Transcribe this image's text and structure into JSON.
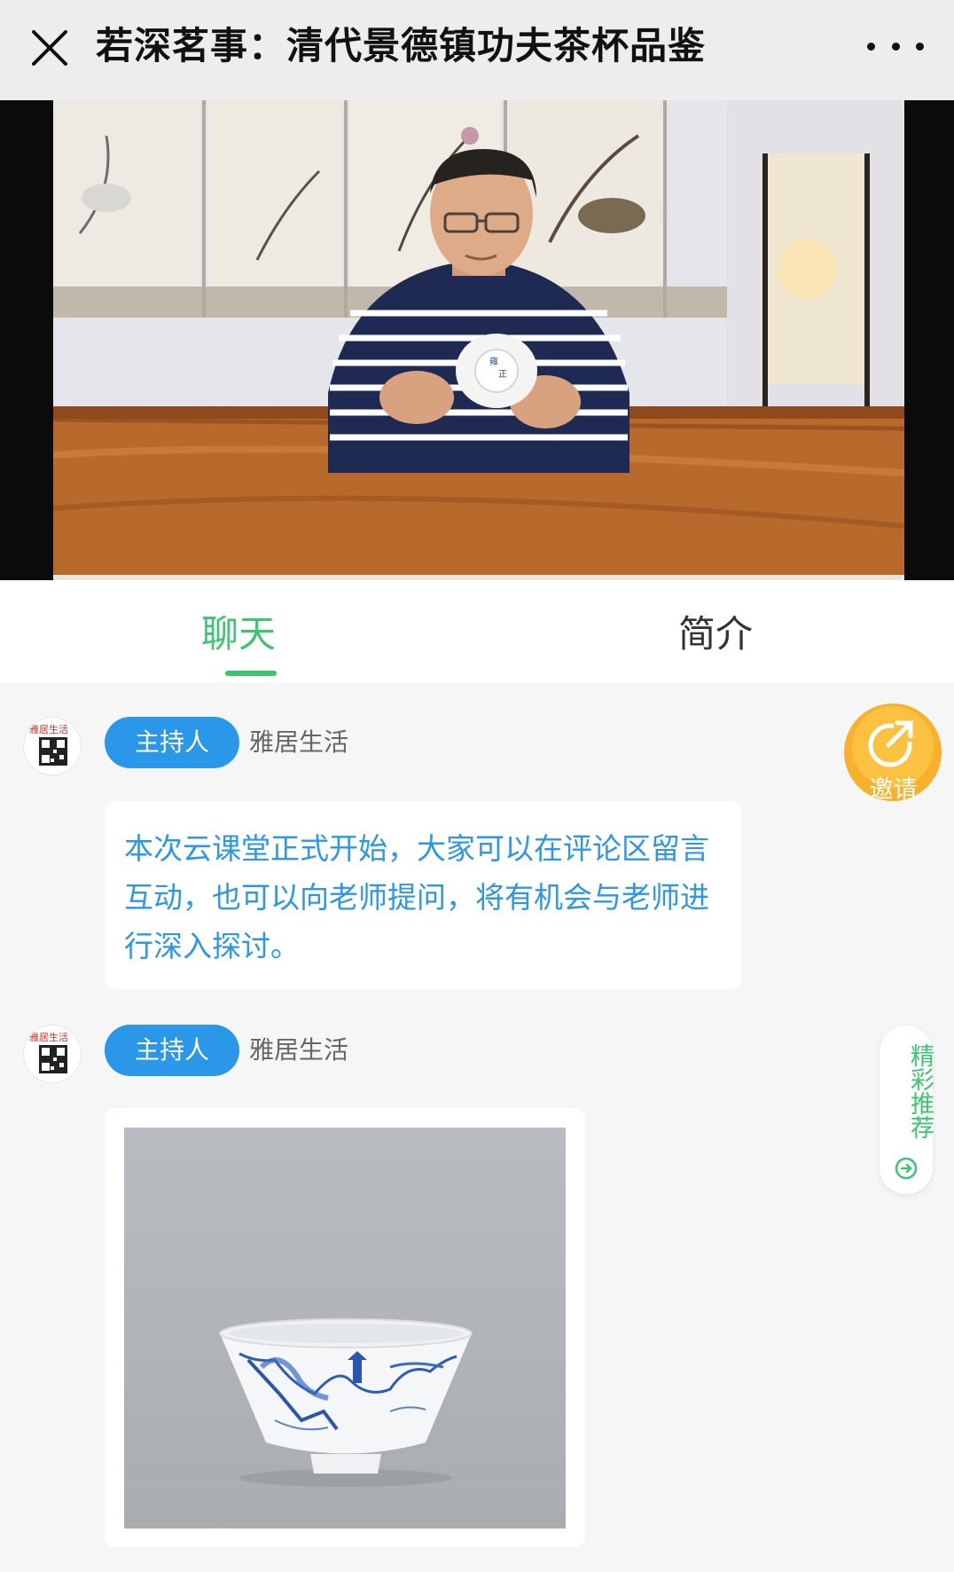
{
  "header": {
    "title": "若深茗事：清代景德镇功夫茶杯品鉴",
    "close_icon": "close-icon",
    "more_icon": "more-dots-icon"
  },
  "tabs": [
    {
      "label": "聊天",
      "active": true
    },
    {
      "label": "简介",
      "active": false
    }
  ],
  "messages": [
    {
      "avatar_text": "雅居生活",
      "role": "主持人",
      "sender": "雅居生活",
      "text": "本次云课堂正式开始，大家可以在评论区留言互动，也可以向老师提问，将有机会与老师进行深入探讨。"
    },
    {
      "avatar_text": "雅居生活",
      "role": "主持人",
      "sender": "雅居生活",
      "image": "blue-and-white-teacup"
    }
  ],
  "floating": {
    "invite_label": "邀请",
    "recommend_label": "精彩推荐"
  },
  "colors": {
    "accent_green": "#3cc56f",
    "blue": "#2a97e8",
    "orange": "#f7b12d"
  }
}
